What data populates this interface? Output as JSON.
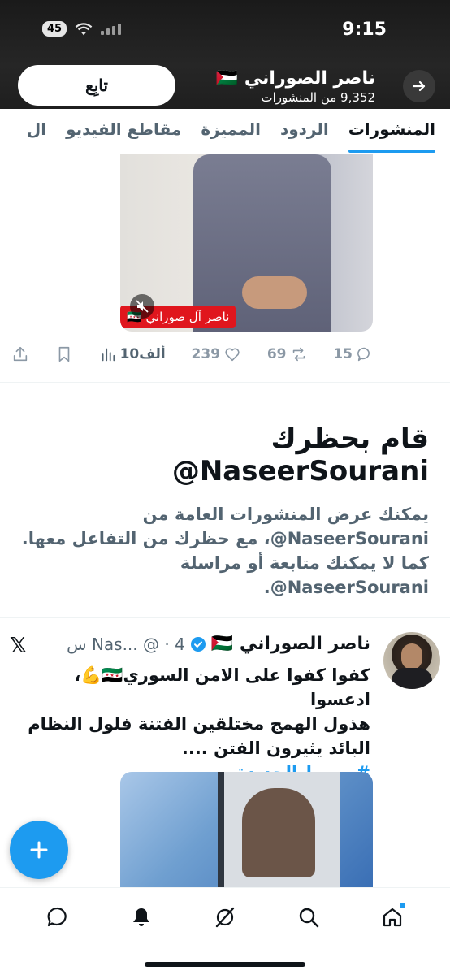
{
  "status_bar": {
    "time": "9:15",
    "battery": "45"
  },
  "header": {
    "follow_label": "تابِع",
    "profile_name": "ناصر الصوراني 🇵🇸",
    "post_count": "9,352 من المنشورات"
  },
  "tabs": [
    {
      "label": "المنشورات",
      "active": true
    },
    {
      "label": "الردود"
    },
    {
      "label": "المميزة"
    },
    {
      "label": "مقاطع الفيديو"
    },
    {
      "label": "ال"
    }
  ],
  "media1": {
    "caption": "ناصر آل صوراني 🇸🇾"
  },
  "actions": {
    "replies": "15",
    "reposts": "69",
    "likes": "239",
    "views": "10ألف"
  },
  "blocked": {
    "title": "قام بحظرك NaseerSourani@",
    "body_line1": "يمكنك عرض المنشورات العامة من",
    "body_line2": "NaseerSourani@، مع حظرك من التفاعل معها.",
    "body_line3": "كما لا يمكنك متابعة أو مراسلة",
    "body_line4": "NaseerSourani@."
  },
  "tweet": {
    "name": "ناصر الصوراني 🇵🇸",
    "meta": "Nas... @ · 4 س",
    "text_line1": "كفوا كفوا على الامن السوري🇸🇾💪، ادعسوا",
    "text_line2": "هذول الهمج مختلقين الفتنة فلول النظام",
    "text_line3": "البائد يثيرون الفتن ....",
    "hashtag": "#سوريا_الجديدة"
  },
  "icons": {
    "back": "arrow-right-icon",
    "verified": "verified-badge-icon",
    "x": "x-logo-icon",
    "compose": "plus-icon"
  },
  "colors": {
    "accent": "#1d9bf0",
    "muted": "#536471",
    "text": "#0f1419",
    "label_red": "#e0161d"
  }
}
